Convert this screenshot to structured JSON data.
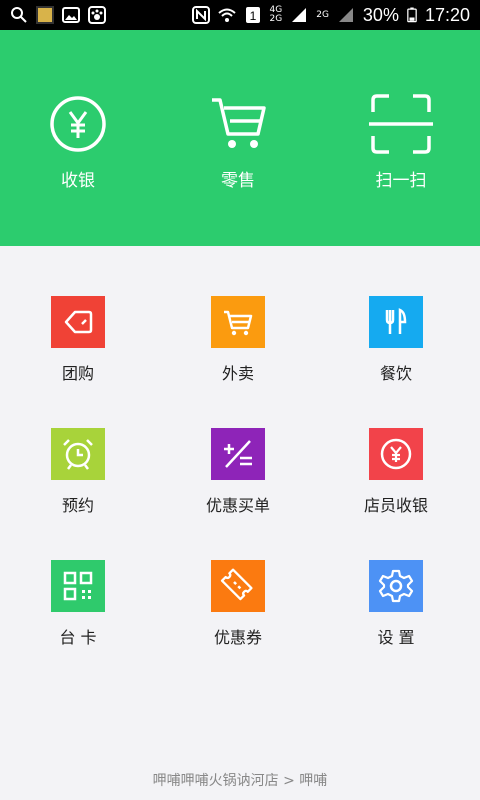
{
  "statusbar": {
    "battery": "30%",
    "time": "17:20",
    "network_top": "4G",
    "network_bottom": "2G",
    "network_small": "2G"
  },
  "hero": {
    "items": [
      {
        "label": "收银",
        "icon": "yen-circle-icon"
      },
      {
        "label": "零售",
        "icon": "cart-icon"
      },
      {
        "label": "扫一扫",
        "icon": "scan-frame-icon"
      }
    ]
  },
  "grid": {
    "items": [
      {
        "label": "团购",
        "icon": "tag-icon",
        "color": "#f04236"
      },
      {
        "label": "外卖",
        "icon": "cart-icon",
        "color": "#fb9b0f"
      },
      {
        "label": "餐饮",
        "icon": "fork-knife-icon",
        "color": "#15aaf0"
      },
      {
        "label": "预约",
        "icon": "alarm-clock-icon",
        "color": "#a8d33a"
      },
      {
        "label": "优惠买单",
        "icon": "plus-minus-equal-icon",
        "color": "#8e24b8"
      },
      {
        "label": "店员收银",
        "icon": "yen-circle-icon",
        "color": "#f2434a"
      },
      {
        "label": "台 卡",
        "icon": "qr-code-icon",
        "color": "#2fca6c"
      },
      {
        "label": "优惠券",
        "icon": "ticket-icon",
        "color": "#fb7a10"
      },
      {
        "label": "设 置",
        "icon": "gear-icon",
        "color": "#4d92f5"
      }
    ]
  },
  "footer": {
    "text": "呷哺呷哺火锅讷河店 > 呷哺"
  }
}
